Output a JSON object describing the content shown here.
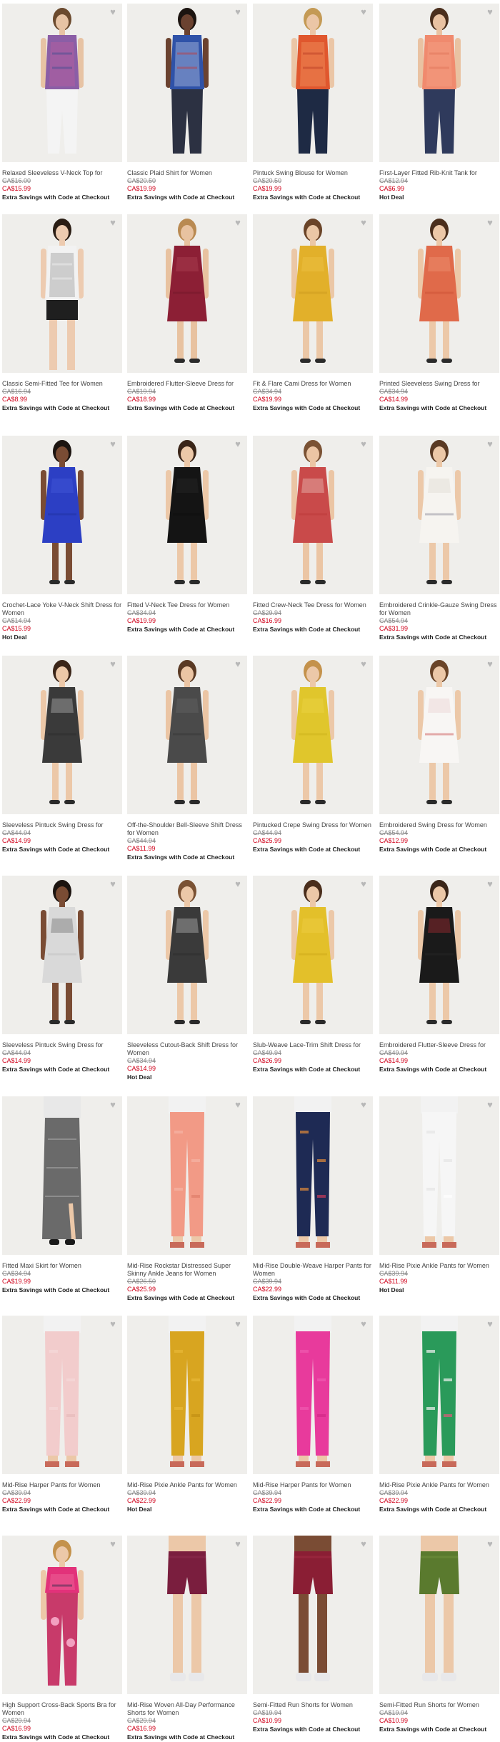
{
  "favorite_icon": "heart-icon",
  "accent_color": "#d0021b",
  "products": [
    {
      "name": "Relaxed Sleeveless V-Neck Top for Women",
      "was": "CA$16.00",
      "now": "CA$15.99",
      "promo": "Extra Savings with Code at Checkout",
      "item": "top",
      "colors": [
        "#8b5ea6",
        "#c85f9c",
        "#3f4d8f"
      ],
      "bottom": "pants",
      "bottom_color": "#f4f4f4",
      "skin": "#e7c3a4",
      "hair": "#6b4a2e"
    },
    {
      "name": "Classic Plaid Shirt for Women",
      "was": "CA$20.50",
      "now": "CA$19.99",
      "promo": "Extra Savings with Code at Checkout",
      "item": "shirt",
      "colors": [
        "#2f52a8",
        "#d2dbef",
        "#c23a3a"
      ],
      "bottom": "pants",
      "bottom_color": "#2c3142",
      "skin": "#6b4230",
      "hair": "#1c1410"
    },
    {
      "name": "Pintuck Swing Blouse for Women",
      "was": "CA$20.50",
      "now": "CA$19.99",
      "promo": "Extra Savings with Code at Checkout",
      "item": "shirt",
      "colors": [
        "#e0572e",
        "#f3a36b",
        "#b83a22"
      ],
      "bottom": "pants",
      "bottom_color": "#1e2a44",
      "skin": "#ebc6a6",
      "hair": "#c49a55"
    },
    {
      "name": "First-Layer Fitted Rib-Knit Tank for Women",
      "was": "CA$12.94",
      "now": "CA$6.99",
      "promo": "Hot Deal",
      "item": "top",
      "colors": [
        "#f08a6e",
        "#f5a58c",
        "#e07459"
      ],
      "bottom": "pants",
      "bottom_color": "#2f3a5c",
      "skin": "#e9c2a2",
      "hair": "#4a2e1c"
    },
    {
      "name": "Classic Semi-Fitted Tee for Women",
      "was": "CA$16.94",
      "now": "CA$8.99",
      "promo": "Extra Savings with Code at Checkout",
      "item": "tee",
      "colors": [
        "#f2f2f2",
        "#8a8a8a",
        "#f2f2f2"
      ],
      "bottom": "shorts",
      "bottom_color": "#1f1f1f",
      "skin": "#edcbb0",
      "hair": "#2a1d14"
    },
    {
      "name": "Embroidered Flutter-Sleeve Dress for Women",
      "was": "CA$19.94",
      "now": "CA$18.99",
      "promo": "Extra Savings with Code at Checkout",
      "item": "dress",
      "colors": [
        "#8c1f35",
        "#b44a5c",
        "#6e1628"
      ],
      "bottom": "none",
      "bottom_color": "#000",
      "skin": "#e8c2a0",
      "hair": "#b98a52"
    },
    {
      "name": "Fit & Flare Cami Dress for Women",
      "was": "CA$34.94",
      "now": "CA$19.99",
      "promo": "Extra Savings with Code at Checkout",
      "item": "dress",
      "colors": [
        "#e2b02a",
        "#f0c84c",
        "#c8961c"
      ],
      "bottom": "none",
      "bottom_color": "#000",
      "skin": "#ebc7a6",
      "hair": "#6a4428"
    },
    {
      "name": "Printed Sleeveless Swing Dress for Women",
      "was": "CA$34.94",
      "now": "CA$14.99",
      "promo": "Extra Savings with Code at Checkout",
      "item": "dress",
      "colors": [
        "#e06a4a",
        "#f29f7e",
        "#c84b30"
      ],
      "bottom": "none",
      "bottom_color": "#000",
      "skin": "#ecc8a8",
      "hair": "#4a2e1c"
    },
    {
      "name": "Crochet-Lace Yoke V-Neck Shift Dress for Women",
      "was": "CA$14.94",
      "now": "CA$15.99",
      "promo": "Hot Deal",
      "item": "dress",
      "colors": [
        "#2c3fc4",
        "#4a5fe0",
        "#1e2e9a"
      ],
      "bottom": "none",
      "bottom_color": "#000",
      "skin": "#7a4c34",
      "hair": "#1c1410"
    },
    {
      "name": "Fitted V-Neck Tee Dress for Women",
      "was": "CA$34.94",
      "now": "CA$19.99",
      "promo": "Extra Savings with Code at Checkout",
      "item": "dress",
      "colors": [
        "#141414",
        "#2a2a2a",
        "#0e0e0e"
      ],
      "bottom": "none",
      "bottom_color": "#000",
      "skin": "#ecc8a8",
      "hair": "#3a2518"
    },
    {
      "name": "Fitted Crew-Neck Tee Dress for Women",
      "was": "CA$29.94",
      "now": "CA$16.99",
      "promo": "Extra Savings with Code at Checkout",
      "item": "dress",
      "colors": [
        "#c94a4a",
        "#f1d9d0",
        "#b83636"
      ],
      "bottom": "none",
      "bottom_color": "#000",
      "skin": "#ebc5a4",
      "hair": "#7a5234"
    },
    {
      "name": "Embroidered Crinkle-Gauze Swing Dress for Women",
      "was": "CA$54.94",
      "now": "CA$31.99",
      "promo": "Extra Savings with Code at Checkout",
      "item": "dress",
      "colors": [
        "#f6f4f0",
        "#d9d4cc",
        "#7a7a8a"
      ],
      "bottom": "none",
      "bottom_color": "#000",
      "skin": "#ecc8a8",
      "hair": "#5a3a24"
    },
    {
      "name": "Sleeveless Pintuck Swing Dress for Women",
      "was": "CA$44.94",
      "now": "CA$14.99",
      "promo": "Extra Savings with Code at Checkout",
      "item": "dress",
      "colors": [
        "#3a3a3a",
        "#cfcfcf",
        "#2a2a2a"
      ],
      "bottom": "none",
      "bottom_color": "#000",
      "skin": "#ecc8a8",
      "hair": "#3a2518"
    },
    {
      "name": "Off-the-Shoulder Bell-Sleeve Shift Dress for Women",
      "was": "CA$44.94",
      "now": "CA$11.99",
      "promo": "Extra Savings with Code at Checkout",
      "item": "dress",
      "colors": [
        "#4a4a4a",
        "#6a6a6a",
        "#333333"
      ],
      "bottom": "none",
      "bottom_color": "#000",
      "skin": "#ebc5a4",
      "hair": "#5a3a24"
    },
    {
      "name": "Pintucked Crepe Swing Dress for Women",
      "was": "CA$44.94",
      "now": "CA$25.99",
      "promo": "Extra Savings with Code at Checkout",
      "item": "dress",
      "colors": [
        "#e0c62c",
        "#efd84e",
        "#c8ae18"
      ],
      "bottom": "none",
      "bottom_color": "#000",
      "skin": "#ecc8a8",
      "hair": "#c4924c"
    },
    {
      "name": "Embroidered Swing Dress for Women",
      "was": "CA$54.94",
      "now": "CA$12.99",
      "promo": "Extra Savings with Code at Checkout",
      "item": "dress",
      "colors": [
        "#f8f6f4",
        "#e8c8c8",
        "#c43a3a"
      ],
      "bottom": "none",
      "bottom_color": "#000",
      "skin": "#ecc8a8",
      "hair": "#6a4428"
    },
    {
      "name": "Sleeveless Pintuck Swing Dress for Women",
      "was": "CA$44.94",
      "now": "CA$14.99",
      "promo": "Extra Savings with Code at Checkout",
      "item": "dress",
      "colors": [
        "#d9d9d9",
        "#5a5a5a",
        "#bcbcbc"
      ],
      "bottom": "none",
      "bottom_color": "#000",
      "skin": "#7a4c34",
      "hair": "#1c1410"
    },
    {
      "name": "Sleeveless Cutout-Back Shift Dress for Women",
      "was": "CA$34.94",
      "now": "CA$14.99",
      "promo": "Hot Deal",
      "item": "dress",
      "colors": [
        "#3a3a3a",
        "#d0d0d0",
        "#2a2a2a"
      ],
      "bottom": "none",
      "bottom_color": "#000",
      "skin": "#ecc8a8",
      "hair": "#7a5234"
    },
    {
      "name": "Slub-Weave Lace-Trim Shift Dress for Women",
      "was": "CA$49.94",
      "now": "CA$26.99",
      "promo": "Extra Savings with Code at Checkout",
      "item": "dress",
      "colors": [
        "#e3c02a",
        "#f0d24e",
        "#c8a416"
      ],
      "bottom": "none",
      "bottom_color": "#000",
      "skin": "#ecc8a8",
      "hair": "#4a2e1c"
    },
    {
      "name": "Embroidered Flutter-Sleeve Dress for Women",
      "was": "CA$49.94",
      "now": "CA$14.99",
      "promo": "Extra Savings with Code at Checkout",
      "item": "dress",
      "colors": [
        "#1a1a1a",
        "#c8303a",
        "#2a2a2a"
      ],
      "bottom": "none",
      "bottom_color": "#000",
      "skin": "#ecc8a8",
      "hair": "#3a2518"
    },
    {
      "name": "Fitted Maxi Skirt for Women",
      "was": "CA$34.94",
      "now": "CA$19.99",
      "promo": "Extra Savings with Code at Checkout",
      "item": "skirt",
      "colors": [
        "#6a6a6a",
        "#b0b0b0",
        "#4a4a4a"
      ],
      "bottom": "none",
      "bottom_color": "#000",
      "skin": "#ecc8a8",
      "hair": "#000"
    },
    {
      "name": "Mid-Rise Rockstar Distressed Super Skinny Ankle Jeans for Women",
      "was": "CA$26.50",
      "now": "CA$25.99",
      "promo": "Extra Savings with Code at Checkout",
      "item": "pants",
      "colors": [
        "#f29a86",
        "#f6b4a4",
        "#e07e6a"
      ],
      "bottom": "none",
      "bottom_color": "#000",
      "skin": "#ecc8a8",
      "hair": "#000"
    },
    {
      "name": "Mid-Rise Double-Weave Harper Pants for Women",
      "was": "CA$39.94",
      "now": "CA$22.99",
      "promo": "Extra Savings with Code at Checkout",
      "item": "pants",
      "colors": [
        "#1e2a54",
        "#e08a3a",
        "#c83a5a"
      ],
      "bottom": "none",
      "bottom_color": "#000",
      "skin": "#ecc8a8",
      "hair": "#000"
    },
    {
      "name": "Mid-Rise Pixie Ankle Pants for Women",
      "was": "CA$39.94",
      "now": "CA$11.99",
      "promo": "Hot Deal",
      "item": "pants",
      "colors": [
        "#f6f6f6",
        "#e6e6e6",
        "#ffffff"
      ],
      "bottom": "none",
      "bottom_color": "#000",
      "skin": "#ecc8a8",
      "hair": "#000"
    },
    {
      "name": "Mid-Rise Harper Pants for Women",
      "was": "CA$39.94",
      "now": "CA$22.99",
      "promo": "Extra Savings with Code at Checkout",
      "item": "pants",
      "colors": [
        "#f2cccc",
        "#f6dada",
        "#e8bcbc"
      ],
      "bottom": "none",
      "bottom_color": "#000",
      "skin": "#ecc8a8",
      "hair": "#000"
    },
    {
      "name": "Mid-Rise Pixie Ankle Pants for Women",
      "was": "CA$39.94",
      "now": "CA$22.99",
      "promo": "Hot Deal",
      "item": "pants",
      "colors": [
        "#d8a520",
        "#e8b838",
        "#c49014"
      ],
      "bottom": "none",
      "bottom_color": "#000",
      "skin": "#ecc8a8",
      "hair": "#000"
    },
    {
      "name": "Mid-Rise Harper Pants for Women",
      "was": "CA$39.94",
      "now": "CA$22.99",
      "promo": "Extra Savings with Code at Checkout",
      "item": "pants",
      "colors": [
        "#e83a9c",
        "#f05ab0",
        "#d42888"
      ],
      "bottom": "none",
      "bottom_color": "#000",
      "skin": "#ecc8a8",
      "hair": "#000"
    },
    {
      "name": "Mid-Rise Pixie Ankle Pants for Women",
      "was": "CA$39.94",
      "now": "CA$22.99",
      "promo": "Extra Savings with Code at Checkout",
      "item": "pants",
      "colors": [
        "#2a9a5a",
        "#f2f2f2",
        "#e05a7a"
      ],
      "bottom": "none",
      "bottom_color": "#000",
      "skin": "#ecc8a8",
      "hair": "#000"
    },
    {
      "name": "High Support Cross-Back Sports Bra for Women",
      "was": "CA$29.94",
      "now": "CA$16.99",
      "promo": "Extra Savings with Code at Checkout",
      "item": "bra",
      "colors": [
        "#e2327a",
        "#f07aa6",
        "#2a2a4a"
      ],
      "bottom": "leggings",
      "bottom_color": "#c83a6a",
      "skin": "#ecc8a8",
      "hair": "#c4924c"
    },
    {
      "name": "Mid-Rise Woven All-Day Performance Shorts for Women",
      "was": "CA$29.94",
      "now": "CA$16.99",
      "promo": "Extra Savings with Code at Checkout",
      "item": "shorts",
      "colors": [
        "#7a1e3e",
        "#8c2a4c",
        "#6a1434"
      ],
      "bottom": "none",
      "bottom_color": "#000",
      "skin": "#ecc8a8",
      "hair": "#000"
    },
    {
      "name": "Semi-Fitted Run Shorts for Women",
      "was": "CA$19.94",
      "now": "CA$10.99",
      "promo": "Extra Savings with Code at Checkout",
      "item": "shorts",
      "colors": [
        "#8a1e34",
        "#a02a42",
        "#741628"
      ],
      "bottom": "none",
      "bottom_color": "#000",
      "skin": "#7a4c34",
      "hair": "#000"
    },
    {
      "name": "Semi-Fitted Run Shorts for Women",
      "was": "CA$19.94",
      "now": "CA$10.99",
      "promo": "Extra Savings with Code at Checkout",
      "item": "shorts",
      "colors": [
        "#5a7a2e",
        "#6e8e3a",
        "#4a6a24"
      ],
      "bottom": "none",
      "bottom_color": "#000",
      "skin": "#ecc8a8",
      "hair": "#000"
    }
  ]
}
